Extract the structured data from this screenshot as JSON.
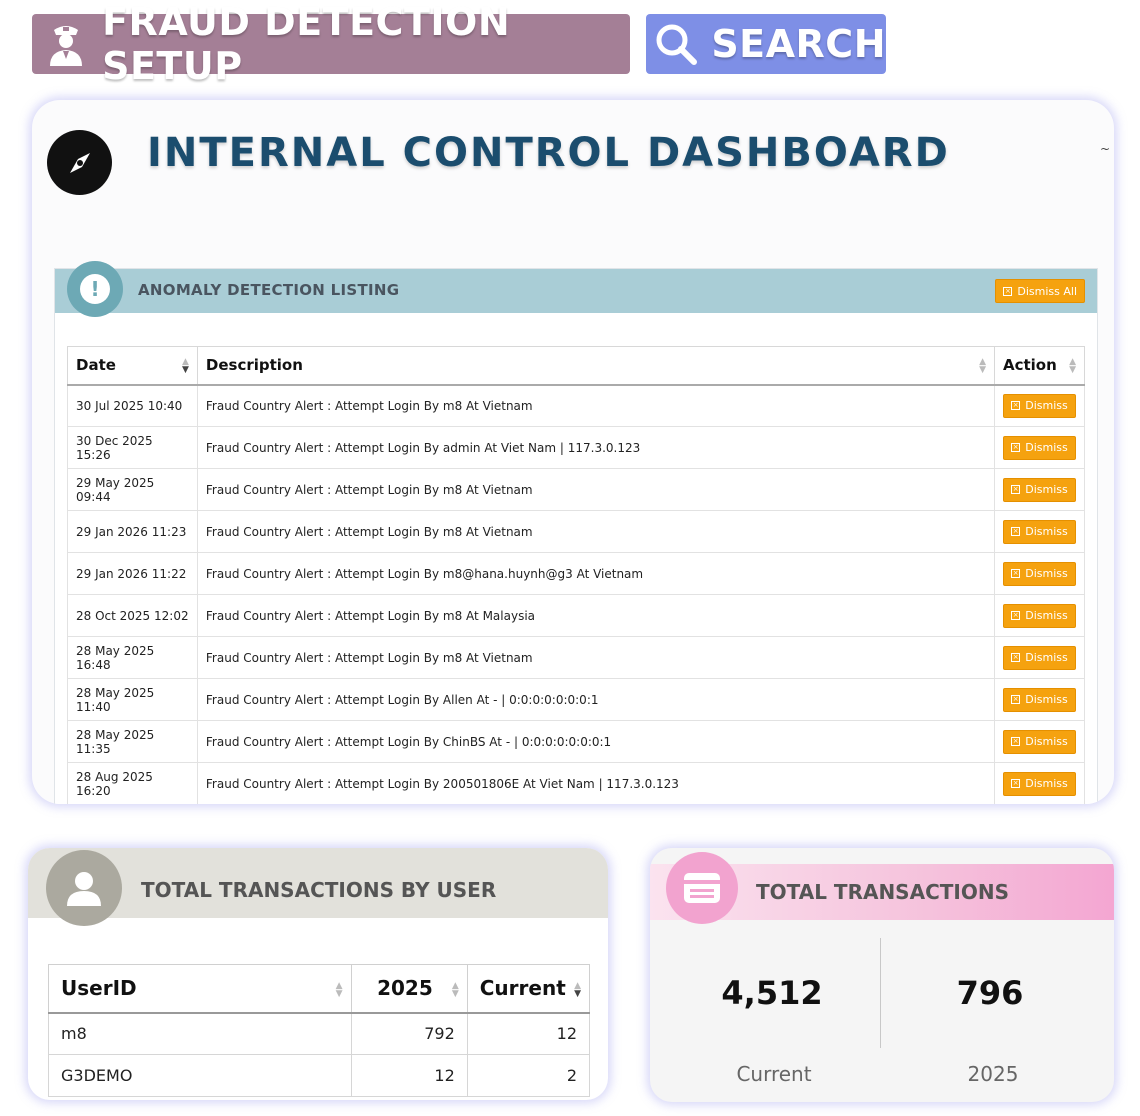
{
  "top_buttons": {
    "fraud_label": "FRAUD DETECTION SETUP",
    "search_label": "SEARCH"
  },
  "dashboard": {
    "title": "INTERNAL CONTROL DASHBOARD"
  },
  "anomaly": {
    "title": "ANOMALY DETECTION LISTING",
    "dismiss_all_label": "Dismiss All",
    "columns": [
      "Date",
      "Description",
      "Action"
    ],
    "dismiss_label": "Dismiss",
    "rows": [
      {
        "date": "30 Jul 2025 10:40",
        "description": "Fraud Country Alert : Attempt Login By m8 At Vietnam"
      },
      {
        "date": "30 Dec 2025 15:26",
        "description": "Fraud Country Alert : Attempt Login By admin At Viet Nam | 117.3.0.123"
      },
      {
        "date": "29 May 2025 09:44",
        "description": "Fraud Country Alert : Attempt Login By m8 At Vietnam"
      },
      {
        "date": "29 Jan 2026 11:23",
        "description": "Fraud Country Alert : Attempt Login By m8 At Vietnam"
      },
      {
        "date": "29 Jan 2026 11:22",
        "description": "Fraud Country Alert : Attempt Login By m8@hana.huynh@g3 At Vietnam"
      },
      {
        "date": "28 Oct 2025 12:02",
        "description": "Fraud Country Alert : Attempt Login By m8 At Malaysia"
      },
      {
        "date": "28 May 2025 16:48",
        "description": "Fraud Country Alert : Attempt Login By m8 At Vietnam"
      },
      {
        "date": "28 May 2025 11:40",
        "description": "Fraud Country Alert : Attempt Login By Allen At - | 0:0:0:0:0:0:0:1"
      },
      {
        "date": "28 May 2025 11:35",
        "description": "Fraud Country Alert : Attempt Login By ChinBS At - | 0:0:0:0:0:0:0:1"
      },
      {
        "date": "28 Aug 2025 16:20",
        "description": "Fraud Country Alert : Attempt Login By 200501806E At Viet Nam | 117.3.0.123"
      }
    ]
  },
  "user_transactions": {
    "title": "TOTAL TRANSACTIONS BY USER",
    "columns": [
      "UserID",
      "2025",
      "Current"
    ],
    "rows": [
      {
        "user": "m8",
        "y2025": "792",
        "current": "12"
      },
      {
        "user": "G3DEMO",
        "y2025": "12",
        "current": "2"
      }
    ]
  },
  "total_transactions": {
    "title": "TOTAL TRANSACTIONS",
    "current_value": "4,512",
    "current_label": "Current",
    "year_value": "796",
    "year_label": "2025"
  },
  "icons": {
    "fraud": "officer-icon",
    "search": "search-icon",
    "dashboard": "compass-icon",
    "anomaly": "alert-icon",
    "user": "user-icon",
    "transactions": "card-icon"
  },
  "colors": {
    "fraud_button": "#a47f96",
    "search_button": "#7e8fe6",
    "dashboard_title": "#1b4d6e",
    "anomaly_header": "#a9cdd6",
    "dismiss": "#f5a20f",
    "user_header": "#e2e1db",
    "transactions_header": "#f4a6d2"
  }
}
